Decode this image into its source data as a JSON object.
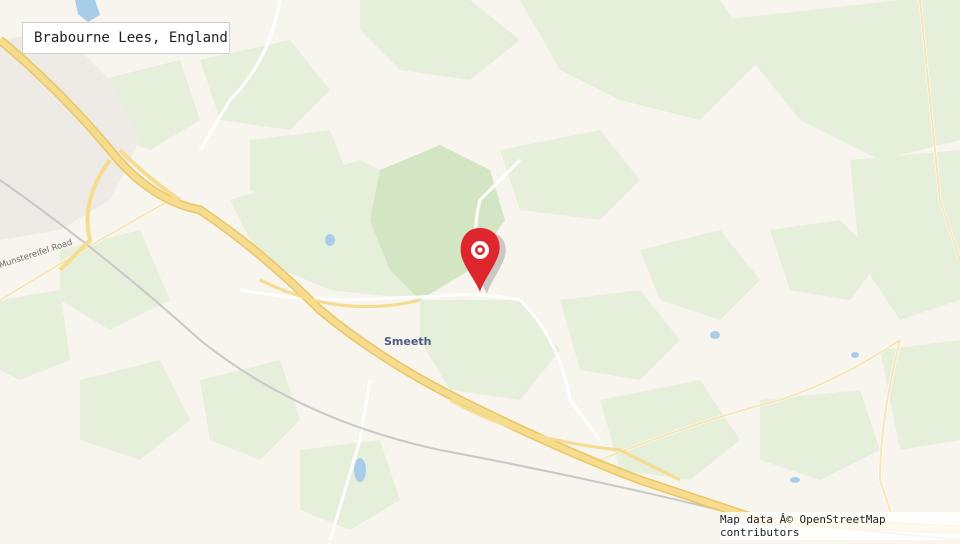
{
  "location_title": "Brabourne Lees, England",
  "attribution": "Map data Â© OpenStreetMap contributors",
  "labels": {
    "place_smeeth": "Smeeth",
    "road_munstereifel": "Munstereifel Road"
  },
  "marker": {
    "name": "map-pin-icon",
    "color": "#e0262d"
  },
  "colors": {
    "land": "#f8f5ef",
    "green": "#e3edd6",
    "forest": "#d7e6c6",
    "motorway": "#f3d37f",
    "water": "#a8cde8"
  }
}
